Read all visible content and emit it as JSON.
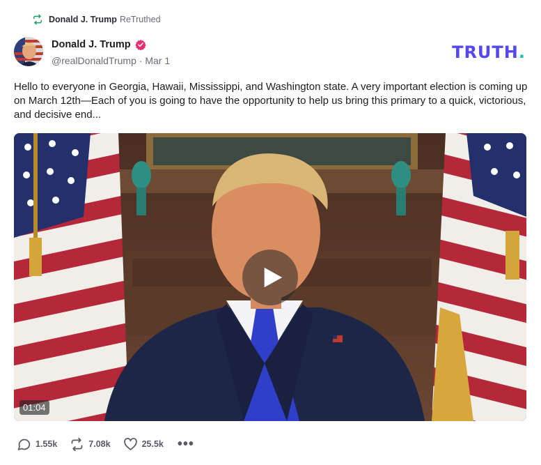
{
  "retruth": {
    "name": "Donald J. Trump",
    "label": "ReTruthed"
  },
  "author": {
    "display_name": "Donald J. Trump",
    "handle": "@realDonaldTrump",
    "separator": "·",
    "date": "Mar 1",
    "verified": true
  },
  "brand": {
    "logo_main": "TRUTH",
    "logo_dot": ".",
    "colors": {
      "primary": "#5448ee",
      "accent": "#17c3b2",
      "verified": "#e4316b",
      "retruth_icon": "#17a05d"
    }
  },
  "post": {
    "text": "Hello to everyone in Georgia, Hawaii, Mississippi, and Washington state. A very important election is coming up on March 12th—Each of you is going to have the opportunity to help us bring this primary to a quick, victorious, and decisive end..."
  },
  "video": {
    "duration": "01:04",
    "play_icon": "play-icon"
  },
  "actions": {
    "replies": "1.55k",
    "retruths": "7.08k",
    "likes": "25.5k",
    "more_label": "•••"
  }
}
